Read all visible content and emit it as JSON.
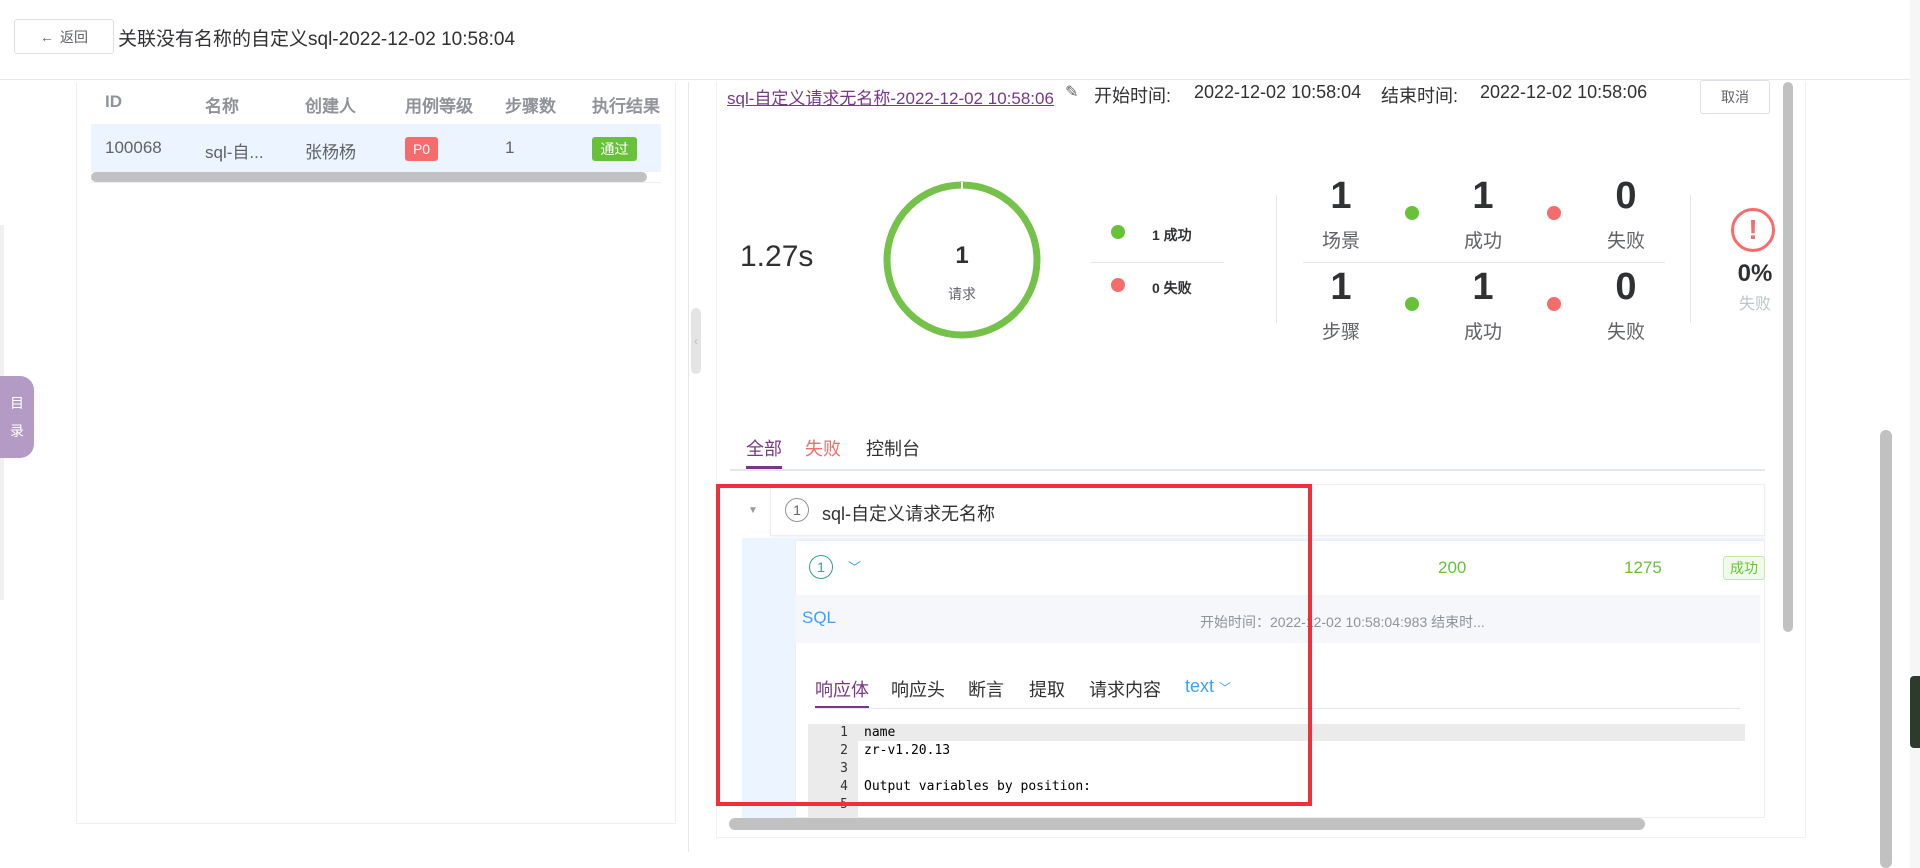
{
  "header": {
    "back_label": "返回",
    "title": "关联没有名称的自定义sql-2022-12-02 10:58:04"
  },
  "side_tab": {
    "line1": "目",
    "line2": "录"
  },
  "left_table": {
    "columns": [
      "ID",
      "名称",
      "创建人",
      "用例等级",
      "步骤数",
      "执行结果"
    ],
    "row": {
      "id": "100068",
      "name": "sql-自...",
      "creator": "张杨杨",
      "level": "P0",
      "steps": "1",
      "result": "通过"
    }
  },
  "report": {
    "name": "sql-自定义请求无名称-2022-12-02 10:58:06",
    "start_label": "开始时间:",
    "start_value": "2022-12-02 10:58:04",
    "end_label": "结束时间:",
    "end_value": "2022-12-02 10:58:06",
    "cancel_label": "取消"
  },
  "summary": {
    "duration": "1.27s",
    "ring_count": "1",
    "ring_label": "请求",
    "legend_success": "1 成功",
    "legend_fail": "0 失败",
    "scenario_count": "1",
    "scenario_label": "场景",
    "scenario_success": "1",
    "scenario_success_label": "成功",
    "scenario_fail": "0",
    "scenario_fail_label": "失败",
    "step_count": "1",
    "step_label": "步骤",
    "step_success": "1",
    "step_success_label": "成功",
    "step_fail": "0",
    "step_fail_label": "失败",
    "fail_pct": "0%",
    "fail_pct_label": "失败"
  },
  "tabs": {
    "all": "全部",
    "fail": "失败",
    "console": "控制台"
  },
  "tree": {
    "index": "1",
    "name": "sql-自定义请求无名称",
    "child": {
      "index": "1",
      "status_code": "200",
      "size": "1275",
      "status": "成功",
      "type": "SQL",
      "time": "开始时间：2022-12-02 10:58:04:983 结束时..."
    }
  },
  "response_tabs": {
    "body": "响应体",
    "headers": "响应头",
    "assert": "断言",
    "extract": "提取",
    "request": "请求内容",
    "format": "text"
  },
  "code": {
    "line_numbers": [
      "1",
      "2",
      "3",
      "4",
      "5"
    ],
    "lines": [
      "name",
      "zr-v1.20.13",
      "",
      "Output variables by position:",
      ""
    ]
  },
  "colors": {
    "accent": "#783887",
    "success": "#67c23a",
    "danger": "#f56c6c",
    "link": "#409eff",
    "highlight": "#ef3038"
  }
}
